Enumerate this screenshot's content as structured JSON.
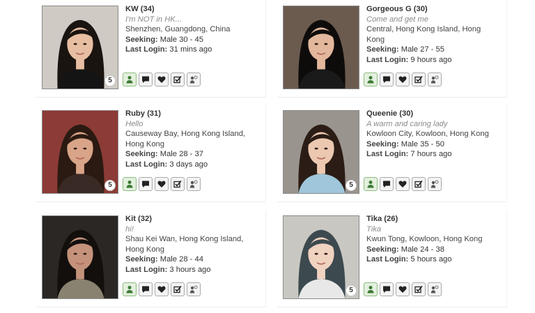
{
  "labels": {
    "seeking": "Seeking:",
    "last_login": "Last Login:"
  },
  "profiles": [
    {
      "name": "KW",
      "age": "(34)",
      "tagline": "I'm NOT in HK...",
      "location": "Shenzhen, Guangdong, China",
      "seeking": "Male 30 - 45",
      "last_login": "31 mins ago",
      "photo_count": "5",
      "colors": {
        "bg": "#cfcac4",
        "hair": "#1a1411",
        "skin": "#e7bea2",
        "top": "#141414"
      }
    },
    {
      "name": "Gorgeous G",
      "age": "(30)",
      "tagline": "Come and get me",
      "location": "Central, Hong Kong Island, Hong Kong",
      "seeking": "Male 27 - 55",
      "last_login": "9 hours ago",
      "photo_count": "",
      "colors": {
        "bg": "#6b5b4f",
        "hair": "#0e0c0b",
        "skin": "#e2b79b",
        "top": "#1a1a1a"
      }
    },
    {
      "name": "Ruby",
      "age": "(31)",
      "tagline": "Hello",
      "location": "Causeway Bay, Hong Kong Island, Hong Kong",
      "seeking": "Male 28 - 37",
      "last_login": "3 days ago",
      "photo_count": "5",
      "colors": {
        "bg": "#8c3b36",
        "hair": "#2a1a12",
        "skin": "#d9a487",
        "top": "#3a2a25"
      }
    },
    {
      "name": "Queenie",
      "age": "(30)",
      "tagline": "A warm and caring lady",
      "location": "Kowloon City, Kowloon, Hong Kong",
      "seeking": "Male 35 - 50",
      "last_login": "7 hours ago",
      "photo_count": "5",
      "colors": {
        "bg": "#9a948e",
        "hair": "#2b1d16",
        "skin": "#ecc8b0",
        "top": "#9fc6da"
      }
    },
    {
      "name": "Kit",
      "age": "(32)",
      "tagline": "hi!",
      "location": "Shau Kei Wan, Hong Kong Island, Hong Kong",
      "seeking": "Male 28 - 44",
      "last_login": "3 hours ago",
      "photo_count": "",
      "colors": {
        "bg": "#2a2725",
        "hair": "#120f0d",
        "skin": "#c4927a",
        "top": "#8a8270"
      }
    },
    {
      "name": "Tika",
      "age": "(26)",
      "tagline": "Tika",
      "location": "Kwun Tong, Kowloon, Hong Kong",
      "seeking": "Male 24 - 38",
      "last_login": "5 hours ago",
      "photo_count": "5",
      "colors": {
        "bg": "#c9c7c2",
        "hair": "#3c4a4f",
        "skin": "#f0d2c0",
        "top": "#e8e8e8"
      }
    }
  ],
  "action_icons": [
    "profile-icon",
    "message-icon",
    "heart-icon",
    "checkbox-icon",
    "wink-icon"
  ],
  "accent": "#8dbb7f"
}
